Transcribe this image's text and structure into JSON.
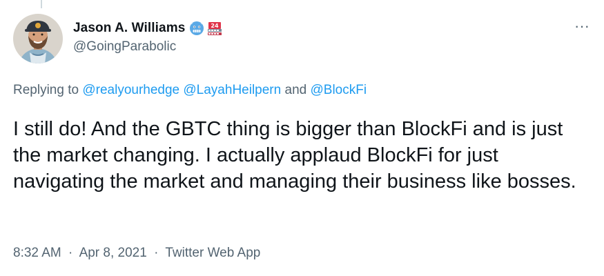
{
  "author": {
    "display_name": "Jason A. Williams",
    "handle": "@GoingParabolic",
    "badges": [
      "cold-face-emoji-icon",
      "calendar-24-emoji-icon"
    ]
  },
  "menu": {
    "more_icon": "more-horizontal-icon",
    "more_label": "···"
  },
  "reply": {
    "prefix": "Replying to",
    "mention_1": "@realyourhedge",
    "mention_2": "@LayahHeilpern",
    "conjunction": "and",
    "mention_3": "@BlockFi"
  },
  "tweet": {
    "text": "I still do! And the GBTC thing is bigger than BlockFi and is just the market changing. I actually applaud BlockFi for just navigating the market and managing their business like bosses."
  },
  "meta": {
    "time": "8:32 AM",
    "separator": "·",
    "date": "Apr 8, 2021",
    "source": "Twitter Web App"
  },
  "colors": {
    "text": "#0f1419",
    "secondary": "#536471",
    "link": "#1d9bf0"
  }
}
